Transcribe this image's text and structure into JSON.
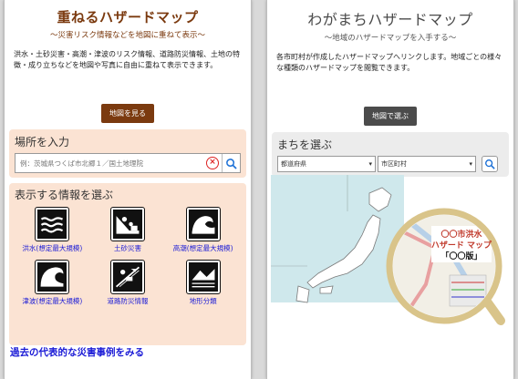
{
  "left": {
    "title": "重ねるハザードマップ",
    "subtitle": "〜災害リスク情報などを地図に重ねて表示〜",
    "description": "洪水・土砂災害・高潮・津波のリスク情報、道路防災情報、土地の特徴・成り立ちなどを地図や写真に自由に重ねて表示できます。",
    "button_label": "地図を見る",
    "place_heading": "場所を入力",
    "search_placeholder": "例：茨城県つくば市北郷１／国土地理院",
    "info_heading": "表示する情報を選ぶ",
    "hazards": [
      {
        "label": "洪水(想定最大規模)",
        "icon": "flood-icon"
      },
      {
        "label": "土砂災害",
        "icon": "landslide-icon"
      },
      {
        "label": "高潮(想定最大規模)",
        "icon": "storm-surge-icon"
      },
      {
        "label": "津波(想定最大規模)",
        "icon": "tsunami-icon"
      },
      {
        "label": "道路防災情報",
        "icon": "road-disaster-icon"
      },
      {
        "label": "地形分類",
        "icon": "terrain-icon"
      }
    ],
    "footer_link": "過去の代表的な災害事例をみる"
  },
  "right": {
    "title": "わがまちハザードマップ",
    "subtitle": "〜地域のハザードマップを入手する〜",
    "description": "各市町村が作成したハザードマップへリンクします。地域ごとの様々な種類のハザードマップを閲覧できます。",
    "button_label": "地図で選ぶ",
    "town_heading": "まちを選ぶ",
    "prefecture_select": "都道府県",
    "city_select": "市区町村",
    "magnifier_text_1": "〇〇市洪水",
    "magnifier_text_2": "ハザード マップ",
    "magnifier_text_3": "「〇〇版」"
  },
  "colors": {
    "left_accent": "#7b3a0f",
    "right_accent": "#4b4b4b",
    "left_panel_bg": "#fbe3d3",
    "link_blue": "#1a1ad6"
  }
}
